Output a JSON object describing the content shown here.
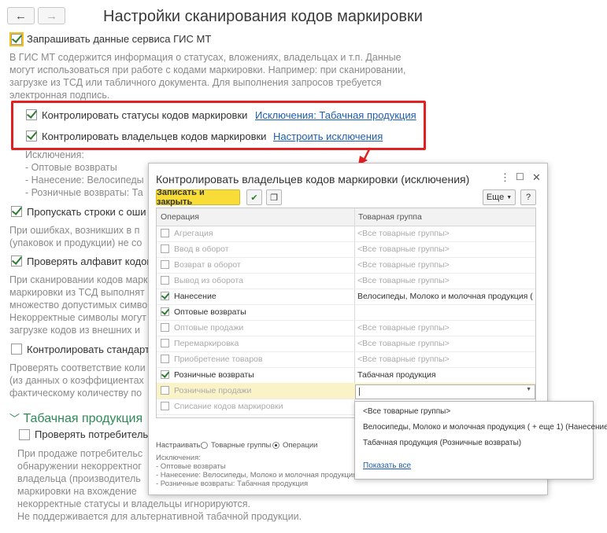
{
  "page": {
    "title": "Настройки сканирования кодов маркировки",
    "nav": {
      "back": "←",
      "forward": "→"
    }
  },
  "settings": {
    "request_gis": {
      "label": "Запрашивать данные сервиса ГИС МТ",
      "checked": true
    },
    "gis_desc": [
      "В ГИС МТ содержится информация о статусах, вложениях, владельцах и т.п. Данные",
      "могут использоваться при работе с кодами маркировки. Например: при сканировании,",
      "загрузке из ТСД или табличного документа. Для выполнения запросов требуется",
      "электронная подпись."
    ],
    "control_statuses": {
      "label": "Контролировать статусы кодов маркировки",
      "link": "Исключения: Табачная продукция",
      "checked": true
    },
    "control_owners": {
      "label": "Контролировать владельцев кодов маркировки",
      "link": "Настроить исключения",
      "checked": true
    },
    "exceptions_text": [
      "Исключения:",
      "- Оптовые возвраты",
      "- Нанесение: Велосипеды",
      "- Розничные возвраты: Та"
    ],
    "skip_rows": {
      "label": "Пропускать строки с оши",
      "checked": true
    },
    "skip_desc": [
      "При ошибках, возникших в п",
      "(упаковок и продукции) не со"
    ],
    "check_alphabet": {
      "label": "Проверять алфавит кодов",
      "checked": true
    },
    "alphabet_desc": [
      "При сканировании кодов марк",
      "маркировки из ТСД выполнят",
      "множество допустимых симво",
      "Некорректные символы могут",
      "загрузке кодов из внешних и"
    ],
    "control_standard": {
      "label": "Контролировать стандарт",
      "checked": false
    },
    "standard_desc": [
      "Проверять соответствие коли",
      "(из данных о коэффициентах",
      "фактическому количеству по"
    ],
    "tobacco_section": "Табачная продукция",
    "check_consumer": {
      "label": "Проверять потребительс",
      "checked": false
    },
    "tobacco_desc": [
      "При продаже потребительс",
      "обнаружении некорректног",
      "владельца (производитель",
      "маркировки на вхождение",
      "некорректные статусы и владельцы игнорируются.",
      "Не поддерживается для альтернативной табачной продукции."
    ]
  },
  "dialog": {
    "title": "Контролировать владельцев кодов маркировки (исключения)",
    "save_close": "Записать и закрыть",
    "more": "Еще",
    "help": "?",
    "columns": {
      "operation": "Операция",
      "group": "Товарная группа"
    },
    "rows": [
      {
        "op": "Агрегация",
        "group": "<Все товарные группы>",
        "checked": false
      },
      {
        "op": "Ввод в оборот",
        "group": "<Все товарные группы>",
        "checked": false
      },
      {
        "op": "Возврат в оборот",
        "group": "<Все товарные группы>",
        "checked": false
      },
      {
        "op": "Вывод из оборота",
        "group": "<Все товарные группы>",
        "checked": false
      },
      {
        "op": "Нанесение",
        "group": "Велосипеды, Молоко и молочная продукция ( + ещ...",
        "checked": true
      },
      {
        "op": "Оптовые возвраты",
        "group": "",
        "checked": true
      },
      {
        "op": "Оптовые продажи",
        "group": "<Все товарные группы>",
        "checked": false
      },
      {
        "op": "Перемаркировка",
        "group": "<Все товарные группы>",
        "checked": false
      },
      {
        "op": "Приобретение товаров",
        "group": "<Все товарные группы>",
        "checked": false
      },
      {
        "op": "Розничные возвраты",
        "group": "Табачная продукция",
        "checked": true
      },
      {
        "op": "Розничные продажи",
        "group": "",
        "checked": false
      },
      {
        "op": "Списание кодов маркировки",
        "group": "",
        "checked": false
      }
    ],
    "customize_label": "Настраивать:",
    "radio_groups": "Товарные группы",
    "radio_ops": "Операции",
    "summary": [
      "Исключения:",
      "- Оптовые возвраты",
      "- Нанесение: Велосипеды, Молоко и молочная продукция, Та",
      "- Розничные возвраты: Табачная продукция"
    ]
  },
  "dropdown": {
    "items": [
      "<Все товарные группы>",
      "Велосипеды, Молоко и молочная продукция ( + еще 1) (Нанесение)",
      "Табачная продукция (Розничные возвраты)"
    ],
    "show_all": "Показать все"
  },
  "colors": {
    "accent_green": "#2e8b57",
    "highlight_red": "#e22020",
    "button_yellow": "#f8dc37",
    "link_blue": "#1f5fb3"
  }
}
